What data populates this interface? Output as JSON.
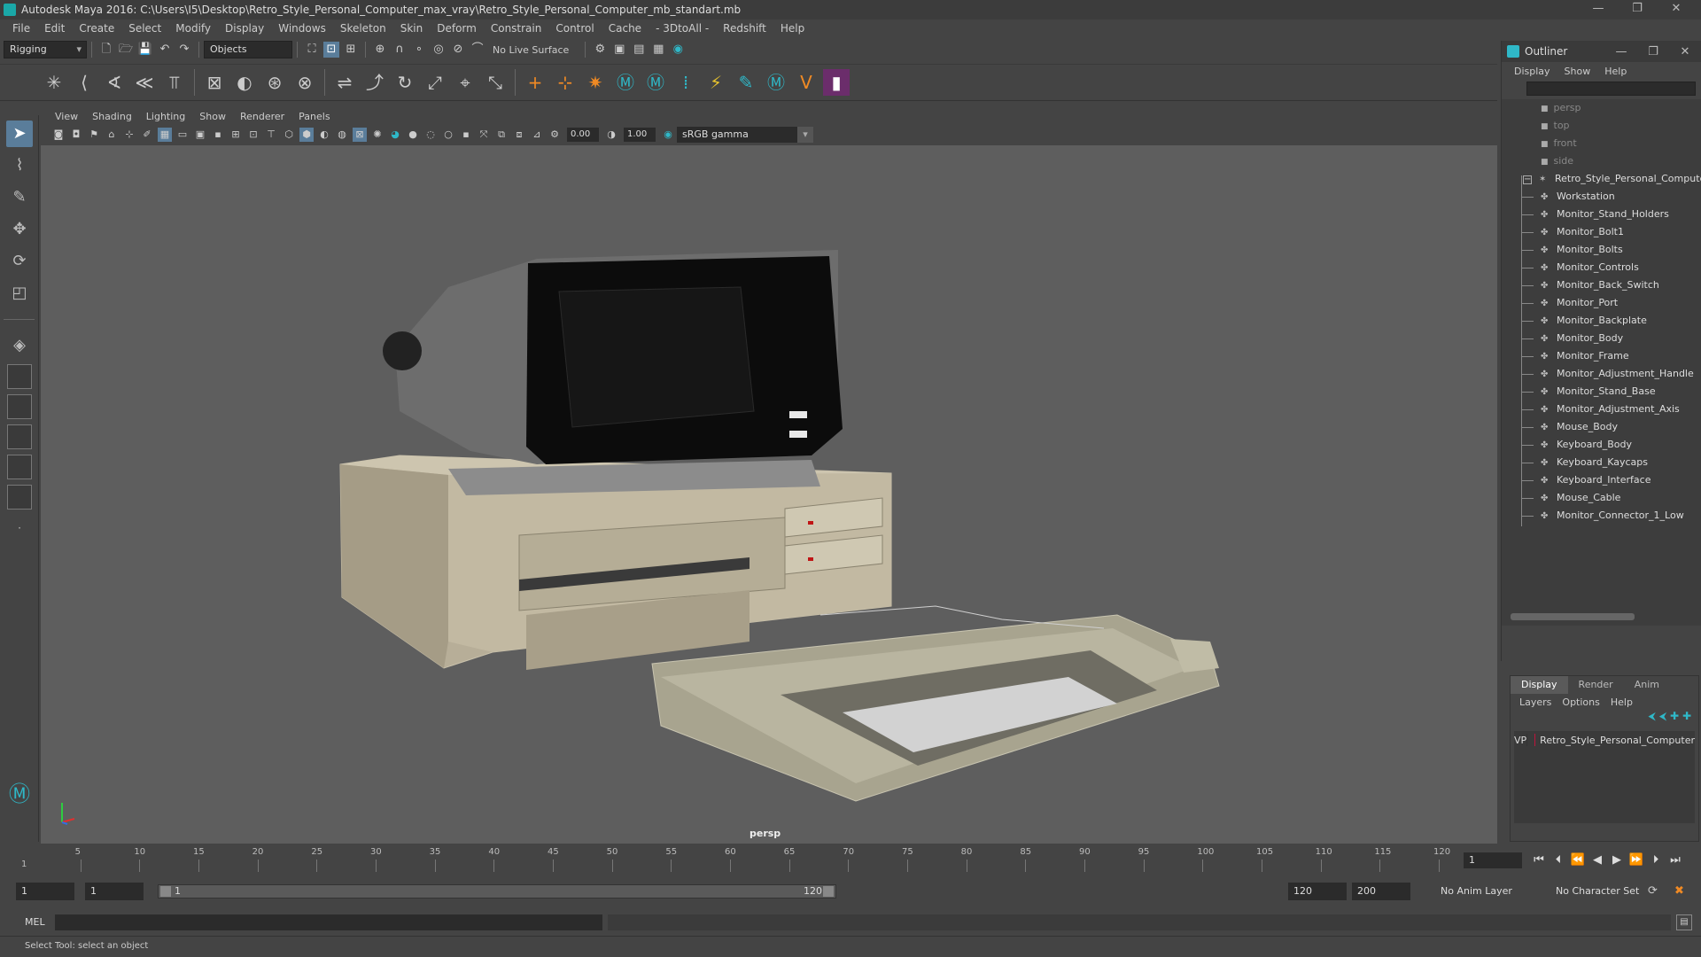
{
  "window": {
    "title": "Autodesk Maya 2016: C:\\Users\\I5\\Desktop\\Retro_Style_Personal_Computer_max_vray\\Retro_Style_Personal_Computer_mb_standart.mb",
    "minimize": "—",
    "maximize": "❐",
    "close": "✕"
  },
  "menubar": [
    "File",
    "Edit",
    "Create",
    "Select",
    "Modify",
    "Display",
    "Windows",
    "Skeleton",
    "Skin",
    "Deform",
    "Constrain",
    "Control",
    "Cache",
    "- 3DtoAll -",
    "Redshift",
    "Help"
  ],
  "status_line": {
    "menuset": "Rigging",
    "selection_mask": "Objects",
    "live_surface": "No Live Surface"
  },
  "panel": {
    "menus": [
      "View",
      "Shading",
      "Lighting",
      "Show",
      "Renderer",
      "Panels"
    ],
    "exposure": "0.00",
    "gamma": "1.00",
    "color_space": "sRGB gamma",
    "camera": "persp"
  },
  "outliner": {
    "title": "Outliner",
    "menus": [
      "Display",
      "Show",
      "Help"
    ],
    "cameras": [
      "persp",
      "top",
      "front",
      "side"
    ],
    "root": "Retro_Style_Personal_Computer",
    "children": [
      "Workstation",
      "Monitor_Stand_Holders",
      "Monitor_Bolt1",
      "Monitor_Bolts",
      "Monitor_Controls",
      "Monitor_Back_Switch",
      "Monitor_Port",
      "Monitor_Backplate",
      "Monitor_Body",
      "Monitor_Frame",
      "Monitor_Adjustment_Handle",
      "Monitor_Stand_Base",
      "Monitor_Adjustment_Axis",
      "Mouse_Body",
      "Keyboard_Body",
      "Keyboard_Kaycaps",
      "Keyboard_Interface",
      "Mouse_Cable",
      "Monitor_Connector_1_Low"
    ]
  },
  "layer_editor": {
    "tabs": [
      "Display",
      "Render",
      "Anim"
    ],
    "menus": [
      "Layers",
      "Options",
      "Help"
    ],
    "layer": {
      "v": "V",
      "p": "P",
      "name": "Retro_Style_Personal_Computer",
      "color": "#c0143c"
    }
  },
  "time_slider": {
    "ticks": [
      "5",
      "10",
      "15",
      "20",
      "25",
      "30",
      "35",
      "40",
      "45",
      "50",
      "55",
      "60",
      "65",
      "70",
      "75",
      "80",
      "85",
      "90",
      "95",
      "100",
      "105",
      "110",
      "115",
      "120"
    ],
    "start_tick": "1",
    "current_frame": "1"
  },
  "range_slider": {
    "start": "1",
    "playback_start": "1",
    "range_start_label": "1",
    "range_end_label": "120",
    "playback_end": "120",
    "end": "200",
    "anim_layer": "No Anim Layer",
    "character_set": "No Character Set"
  },
  "command_line": {
    "label": "MEL"
  },
  "help_line": "Select Tool: select an object",
  "colors": {
    "accent": "#2fb8c8",
    "active_tool": "#5a7d9a",
    "layer": "#c0143c"
  }
}
